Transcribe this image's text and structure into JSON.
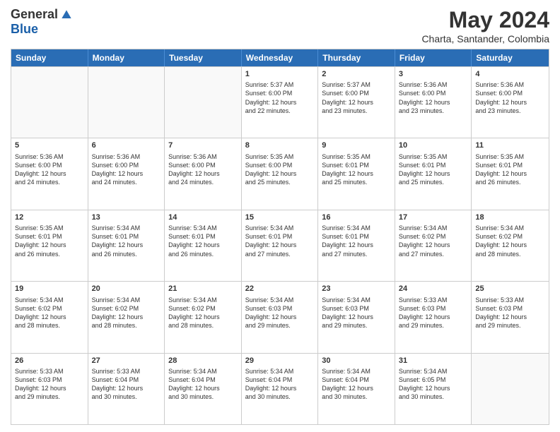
{
  "logo": {
    "general": "General",
    "blue": "Blue"
  },
  "title": "May 2024",
  "location": "Charta, Santander, Colombia",
  "days_of_week": [
    "Sunday",
    "Monday",
    "Tuesday",
    "Wednesday",
    "Thursday",
    "Friday",
    "Saturday"
  ],
  "weeks": [
    [
      {
        "day": "",
        "info": ""
      },
      {
        "day": "",
        "info": ""
      },
      {
        "day": "",
        "info": ""
      },
      {
        "day": "1",
        "info": "Sunrise: 5:37 AM\nSunset: 6:00 PM\nDaylight: 12 hours\nand 22 minutes."
      },
      {
        "day": "2",
        "info": "Sunrise: 5:37 AM\nSunset: 6:00 PM\nDaylight: 12 hours\nand 23 minutes."
      },
      {
        "day": "3",
        "info": "Sunrise: 5:36 AM\nSunset: 6:00 PM\nDaylight: 12 hours\nand 23 minutes."
      },
      {
        "day": "4",
        "info": "Sunrise: 5:36 AM\nSunset: 6:00 PM\nDaylight: 12 hours\nand 23 minutes."
      }
    ],
    [
      {
        "day": "5",
        "info": "Sunrise: 5:36 AM\nSunset: 6:00 PM\nDaylight: 12 hours\nand 24 minutes."
      },
      {
        "day": "6",
        "info": "Sunrise: 5:36 AM\nSunset: 6:00 PM\nDaylight: 12 hours\nand 24 minutes."
      },
      {
        "day": "7",
        "info": "Sunrise: 5:36 AM\nSunset: 6:00 PM\nDaylight: 12 hours\nand 24 minutes."
      },
      {
        "day": "8",
        "info": "Sunrise: 5:35 AM\nSunset: 6:00 PM\nDaylight: 12 hours\nand 25 minutes."
      },
      {
        "day": "9",
        "info": "Sunrise: 5:35 AM\nSunset: 6:01 PM\nDaylight: 12 hours\nand 25 minutes."
      },
      {
        "day": "10",
        "info": "Sunrise: 5:35 AM\nSunset: 6:01 PM\nDaylight: 12 hours\nand 25 minutes."
      },
      {
        "day": "11",
        "info": "Sunrise: 5:35 AM\nSunset: 6:01 PM\nDaylight: 12 hours\nand 26 minutes."
      }
    ],
    [
      {
        "day": "12",
        "info": "Sunrise: 5:35 AM\nSunset: 6:01 PM\nDaylight: 12 hours\nand 26 minutes."
      },
      {
        "day": "13",
        "info": "Sunrise: 5:34 AM\nSunset: 6:01 PM\nDaylight: 12 hours\nand 26 minutes."
      },
      {
        "day": "14",
        "info": "Sunrise: 5:34 AM\nSunset: 6:01 PM\nDaylight: 12 hours\nand 26 minutes."
      },
      {
        "day": "15",
        "info": "Sunrise: 5:34 AM\nSunset: 6:01 PM\nDaylight: 12 hours\nand 27 minutes."
      },
      {
        "day": "16",
        "info": "Sunrise: 5:34 AM\nSunset: 6:01 PM\nDaylight: 12 hours\nand 27 minutes."
      },
      {
        "day": "17",
        "info": "Sunrise: 5:34 AM\nSunset: 6:02 PM\nDaylight: 12 hours\nand 27 minutes."
      },
      {
        "day": "18",
        "info": "Sunrise: 5:34 AM\nSunset: 6:02 PM\nDaylight: 12 hours\nand 28 minutes."
      }
    ],
    [
      {
        "day": "19",
        "info": "Sunrise: 5:34 AM\nSunset: 6:02 PM\nDaylight: 12 hours\nand 28 minutes."
      },
      {
        "day": "20",
        "info": "Sunrise: 5:34 AM\nSunset: 6:02 PM\nDaylight: 12 hours\nand 28 minutes."
      },
      {
        "day": "21",
        "info": "Sunrise: 5:34 AM\nSunset: 6:02 PM\nDaylight: 12 hours\nand 28 minutes."
      },
      {
        "day": "22",
        "info": "Sunrise: 5:34 AM\nSunset: 6:03 PM\nDaylight: 12 hours\nand 29 minutes."
      },
      {
        "day": "23",
        "info": "Sunrise: 5:34 AM\nSunset: 6:03 PM\nDaylight: 12 hours\nand 29 minutes."
      },
      {
        "day": "24",
        "info": "Sunrise: 5:33 AM\nSunset: 6:03 PM\nDaylight: 12 hours\nand 29 minutes."
      },
      {
        "day": "25",
        "info": "Sunrise: 5:33 AM\nSunset: 6:03 PM\nDaylight: 12 hours\nand 29 minutes."
      }
    ],
    [
      {
        "day": "26",
        "info": "Sunrise: 5:33 AM\nSunset: 6:03 PM\nDaylight: 12 hours\nand 29 minutes."
      },
      {
        "day": "27",
        "info": "Sunrise: 5:33 AM\nSunset: 6:04 PM\nDaylight: 12 hours\nand 30 minutes."
      },
      {
        "day": "28",
        "info": "Sunrise: 5:34 AM\nSunset: 6:04 PM\nDaylight: 12 hours\nand 30 minutes."
      },
      {
        "day": "29",
        "info": "Sunrise: 5:34 AM\nSunset: 6:04 PM\nDaylight: 12 hours\nand 30 minutes."
      },
      {
        "day": "30",
        "info": "Sunrise: 5:34 AM\nSunset: 6:04 PM\nDaylight: 12 hours\nand 30 minutes."
      },
      {
        "day": "31",
        "info": "Sunrise: 5:34 AM\nSunset: 6:05 PM\nDaylight: 12 hours\nand 30 minutes."
      },
      {
        "day": "",
        "info": ""
      }
    ]
  ]
}
